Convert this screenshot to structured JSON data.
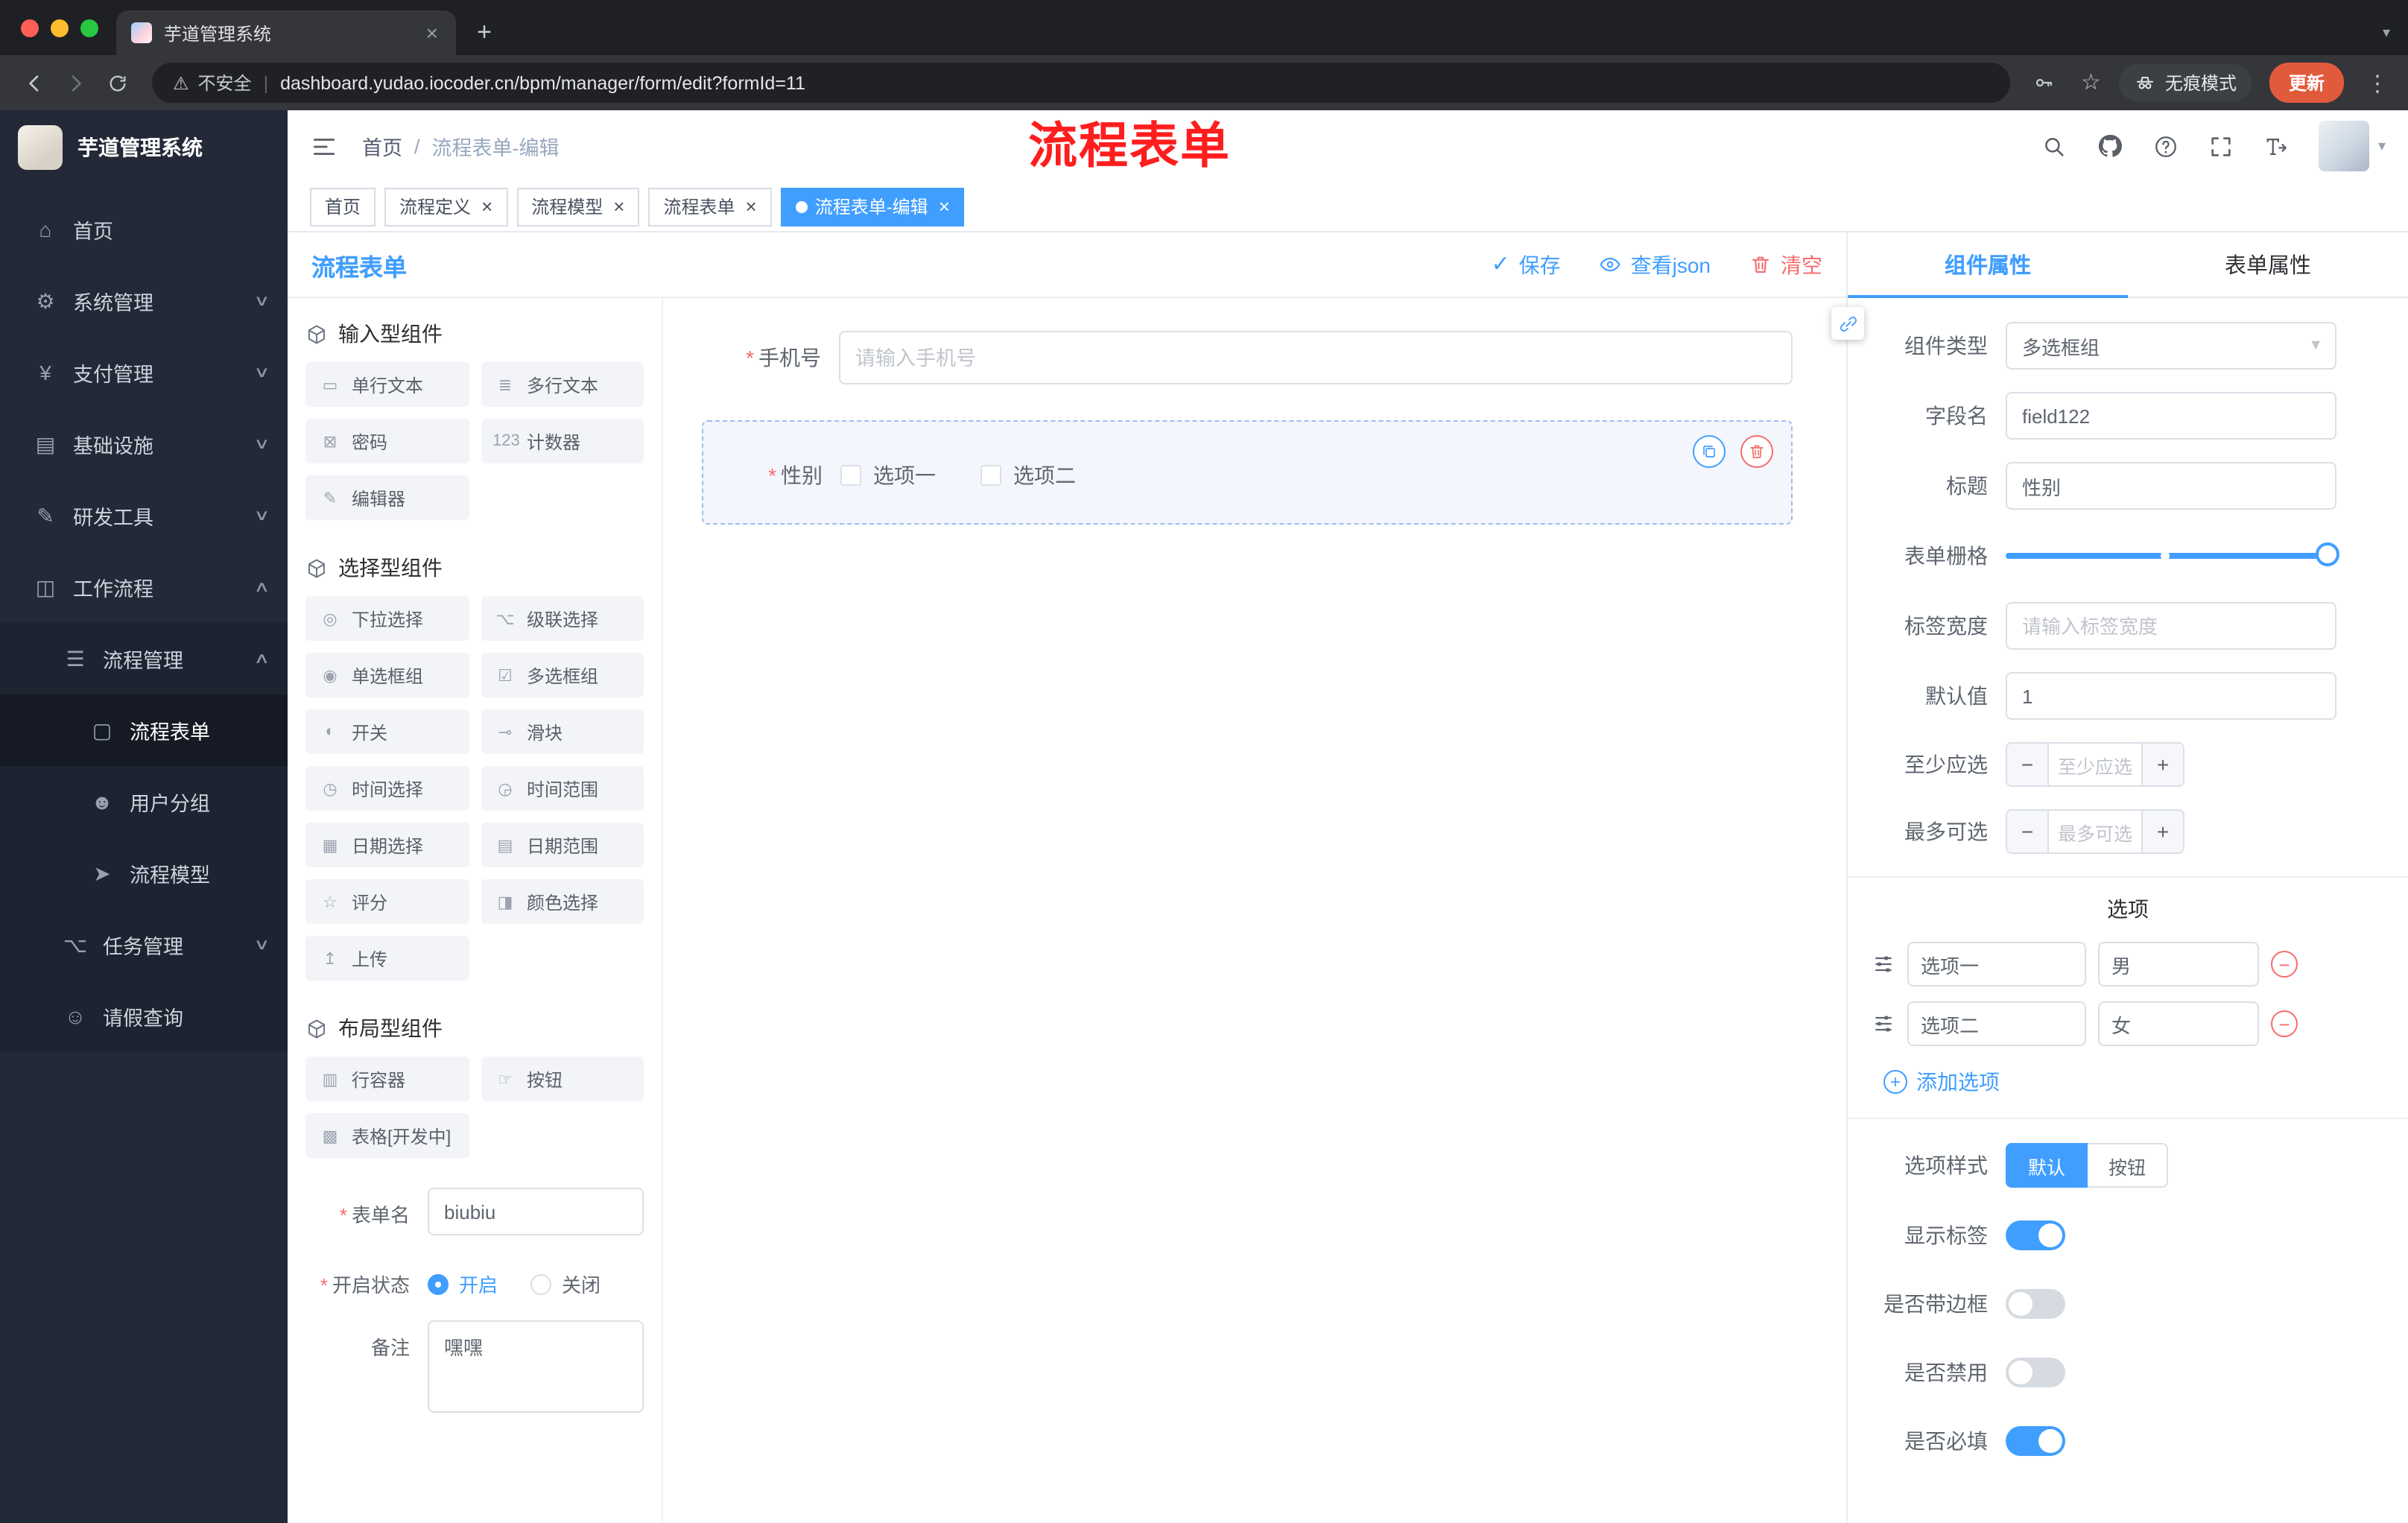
{
  "browser": {
    "tab_title": "芋道管理系统",
    "security_label": "不安全",
    "url": "dashboard.yudao.iocoder.cn/bpm/manager/form/edit?formId=11",
    "incognito_label": "无痕模式",
    "update_label": "更新"
  },
  "sidebar": {
    "app_title": "芋道管理系统",
    "items": [
      {
        "label": "首页",
        "icon": "⌂"
      },
      {
        "label": "系统管理",
        "icon": "⚙",
        "has_chevron": true
      },
      {
        "label": "支付管理",
        "icon": "¥",
        "has_chevron": true
      },
      {
        "label": "基础设施",
        "icon": "▤",
        "has_chevron": true
      },
      {
        "label": "研发工具",
        "icon": "✎",
        "has_chevron": true
      },
      {
        "label": "工作流程",
        "icon": "◫",
        "has_chevron": true,
        "open": true
      },
      {
        "label": "流程管理",
        "icon": "☰",
        "sub": true,
        "has_chevron": true,
        "open": true
      },
      {
        "label": "流程表单",
        "icon": "▢",
        "leaf": true,
        "active": true
      },
      {
        "label": "用户分组",
        "icon": "☻",
        "leaf": true
      },
      {
        "label": "流程模型",
        "icon": "➤",
        "leaf": true
      },
      {
        "label": "任务管理",
        "icon": "⌥",
        "sub": true,
        "has_chevron": true
      },
      {
        "label": "请假查询",
        "icon": "☺",
        "sub": true
      }
    ]
  },
  "header": {
    "breadcrumb_home": "首页",
    "breadcrumb_separator": "/",
    "breadcrumb_current": "流程表单-编辑",
    "annotation": "流程表单"
  },
  "tags": [
    {
      "label": "首页"
    },
    {
      "label": "流程定义",
      "closable": true
    },
    {
      "label": "流程模型",
      "closable": true
    },
    {
      "label": "流程表单",
      "closable": true
    },
    {
      "label": "流程表单-编辑",
      "closable": true,
      "active": true
    }
  ],
  "designer": {
    "title": "流程表单",
    "actions": {
      "save": "保存",
      "view_json": "查看json",
      "clear": "清空"
    },
    "palette": {
      "group_input": {
        "title": "输入型组件",
        "items": [
          {
            "icon": "▭",
            "label": "单行文本"
          },
          {
            "icon": "≣",
            "label": "多行文本"
          },
          {
            "icon": "⊠",
            "label": "密码"
          },
          {
            "icon": "123",
            "label": "计数器"
          },
          {
            "icon": "✎",
            "label": "编辑器"
          }
        ]
      },
      "group_select": {
        "title": "选择型组件",
        "items": [
          {
            "icon": "◎",
            "label": "下拉选择"
          },
          {
            "icon": "⌥",
            "label": "级联选择"
          },
          {
            "icon": "◉",
            "label": "单选框组"
          },
          {
            "icon": "☑",
            "label": "多选框组"
          },
          {
            "icon": "◐",
            "label": "开关"
          },
          {
            "icon": "⊸",
            "label": "滑块"
          },
          {
            "icon": "◷",
            "label": "时间选择"
          },
          {
            "icon": "◶",
            "label": "时间范围"
          },
          {
            "icon": "▦",
            "label": "日期选择"
          },
          {
            "icon": "▤",
            "label": "日期范围"
          },
          {
            "icon": "☆",
            "label": "评分"
          },
          {
            "icon": "◨",
            "label": "颜色选择"
          },
          {
            "icon": "↥",
            "label": "上传"
          }
        ]
      },
      "group_layout": {
        "title": "布局型组件",
        "items": [
          {
            "icon": "▥",
            "label": "行容器"
          },
          {
            "icon": "☞",
            "label": "按钮"
          },
          {
            "icon": "▩",
            "label": "表格[开发中]"
          }
        ]
      }
    },
    "form_meta": {
      "name_label": "表单名",
      "name_value": "biubiu",
      "status_label": "开启状态",
      "status_on": "开启",
      "status_off": "关闭",
      "remark_label": "备注",
      "remark_value": "嘿嘿"
    },
    "canvas": {
      "phone_label": "手机号",
      "phone_placeholder": "请输入手机号",
      "gender_label": "性别",
      "gender_option1": "选项一",
      "gender_option2": "选项二"
    }
  },
  "props": {
    "tab_component": "组件属性",
    "tab_form": "表单属性",
    "component_type_label": "组件类型",
    "component_type_value": "多选框组",
    "field_name_label": "字段名",
    "field_name_value": "field122",
    "title_label": "标题",
    "title_value": "性别",
    "grid_label": "表单栅格",
    "label_width_label": "标签宽度",
    "label_width_placeholder": "请输入标签宽度",
    "default_label": "默认值",
    "default_value": "1",
    "min_label": "至少应选",
    "min_placeholder": "至少应选",
    "max_label": "最多可选",
    "max_placeholder": "最多可选",
    "options_title": "选项",
    "options": [
      {
        "label": "选项一",
        "value": "男"
      },
      {
        "label": "选项二",
        "value": "女"
      }
    ],
    "add_option_label": "添加选项",
    "option_style_label": "选项样式",
    "style_default": "默认",
    "style_button": "按钮",
    "toggles": [
      {
        "label": "显示标签",
        "on": true
      },
      {
        "label": "是否带边框",
        "on": false
      },
      {
        "label": "是否禁用",
        "on": false
      },
      {
        "label": "是否必填",
        "on": true
      }
    ],
    "colors": {
      "accent": "#409eff",
      "danger": "#f56c6c"
    }
  }
}
